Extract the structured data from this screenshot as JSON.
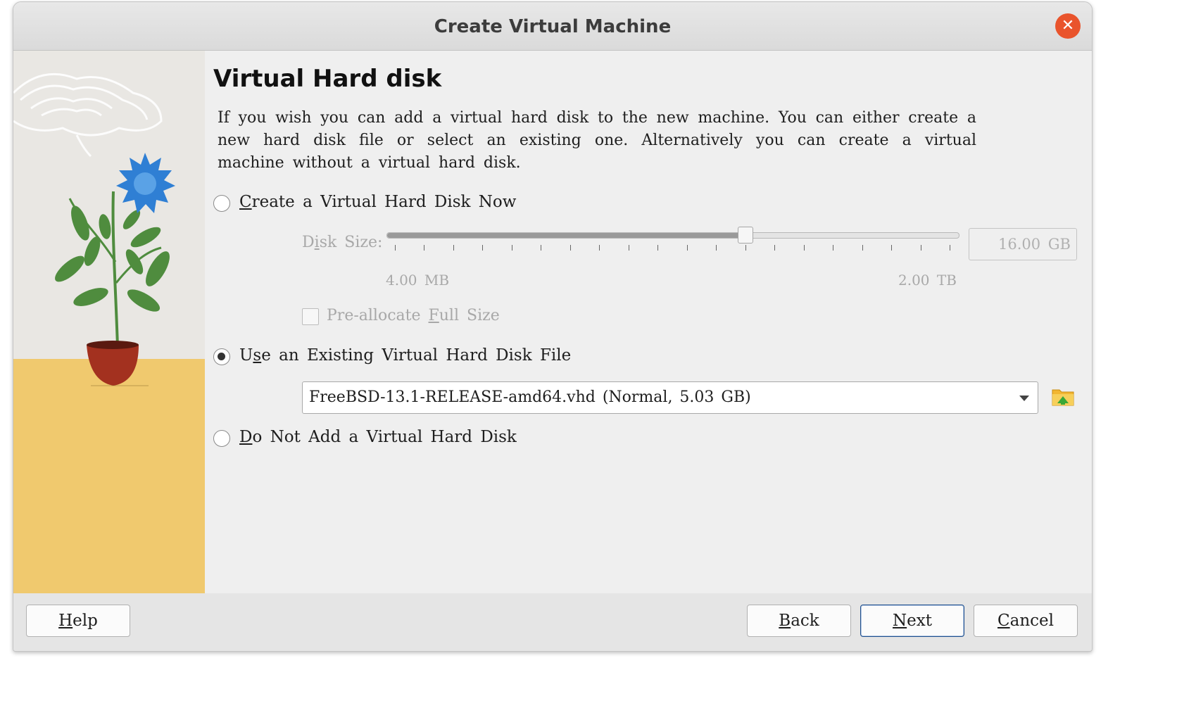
{
  "window": {
    "title": "Create Virtual Machine"
  },
  "heading": "Virtual Hard disk",
  "description": "If you wish you can add a virtual hard disk to the new machine. You can either create a new hard disk file or select an existing one. Alternatively you can create a virtual machine without a virtual hard disk.",
  "options": {
    "create_now": {
      "mnemonic": "C",
      "rest": "reate a Virtual Hard Disk Now",
      "selected": false
    },
    "use_existing": {
      "pre": "U",
      "mnemonic": "s",
      "rest": "e an Existing Virtual Hard Disk File",
      "selected": true
    },
    "do_not_add": {
      "mnemonic": "D",
      "rest": "o Not Add a Virtual Hard Disk",
      "selected": false
    }
  },
  "disk_size": {
    "label_pre": "D",
    "label_mnemonic": "i",
    "label_rest": "sk Size:",
    "min_label": "4.00 MB",
    "max_label": "2.00 TB",
    "value_text": "16.00 GB",
    "slider_fraction": 0.626,
    "tick_count": 20,
    "enabled": false
  },
  "preallocate": {
    "pre": "Pre-allocate ",
    "mnemonic": "F",
    "rest": "ull Size",
    "checked": false
  },
  "existing_disk": {
    "selected": "FreeBSD-13.1-RELEASE-amd64.vhd (Normal, 5.03 GB)"
  },
  "buttons": {
    "help": {
      "mnemonic": "H",
      "rest": "elp"
    },
    "back": {
      "mnemonic": "B",
      "rest": "ack"
    },
    "next": {
      "mnemonic": "N",
      "rest": "ext"
    },
    "cancel": {
      "mnemonic": "C",
      "rest": "ancel"
    }
  },
  "colors": {
    "close_button": "#e9542c",
    "art_floor": "#f0c96e",
    "flower": "#2f7fd4",
    "leaves": "#4f8c3e",
    "pot": "#a3311f",
    "default_button_border": "#1e4e8c"
  },
  "icons": {
    "close": "close-icon",
    "folder": "folder-add-icon",
    "dropdown": "chevron-down-icon"
  }
}
